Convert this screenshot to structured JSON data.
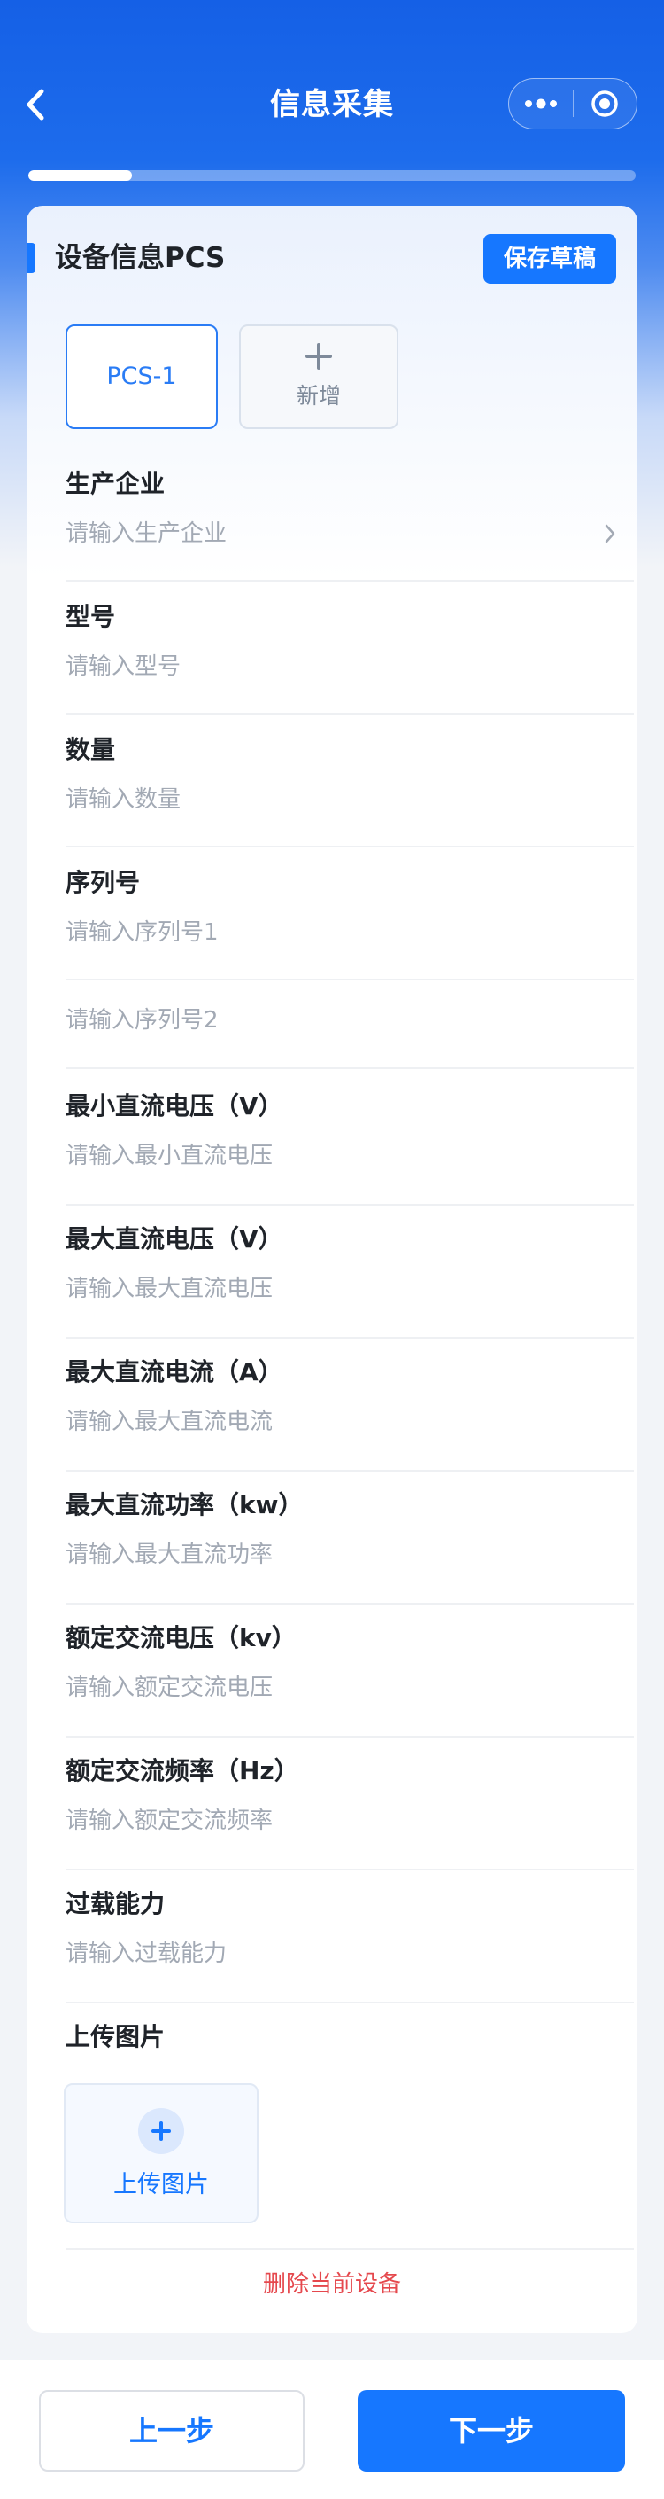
{
  "nav": {
    "title": "信息采集",
    "back_icon": "chevron-left-icon",
    "more_icon": "more-dots-icon",
    "target_icon": "target-icon"
  },
  "progress": {
    "fraction": 0.17
  },
  "section": {
    "title": "设备信息PCS",
    "save_draft_label": "保存草稿"
  },
  "device_tabs": [
    {
      "label": "PCS-1",
      "selected": true
    }
  ],
  "add_tab": {
    "label": "新增"
  },
  "fields": [
    {
      "label": "生产企业",
      "placeholder": "请输入生产企业",
      "has_arrow": true
    },
    {
      "label": "型号",
      "placeholder": "请输入型号"
    },
    {
      "label": "数量",
      "placeholder": "请输入数量"
    },
    {
      "label": "序列号",
      "placeholder": "请输入序列号1"
    },
    {
      "label": "",
      "placeholder": "请输入序列号2"
    },
    {
      "label": "最小直流电压（V）",
      "placeholder": "请输入最小直流电压"
    },
    {
      "label": "最大直流电压（V）",
      "placeholder": "请输入最大直流电压"
    },
    {
      "label": "最大直流电流（A）",
      "placeholder": "请输入最大直流电流"
    },
    {
      "label": "最大直流功率（kw）",
      "placeholder": "请输入最大直流功率"
    },
    {
      "label": "额定交流电压（kv）",
      "placeholder": "请输入额定交流电压"
    },
    {
      "label": "额定交流频率（Hz）",
      "placeholder": "请输入额定交流频率"
    },
    {
      "label": "过载能力",
      "placeholder": "请输入过载能力"
    }
  ],
  "upload": {
    "section_label": "上传图片",
    "button_label": "上传图片"
  },
  "delete_label": "删除当前设备",
  "footer": {
    "prev_label": "上一步",
    "next_label": "下一步"
  },
  "colors": {
    "primary": "#1677ff",
    "danger": "#e5484d",
    "header_gradient_top": "#1560e6"
  }
}
